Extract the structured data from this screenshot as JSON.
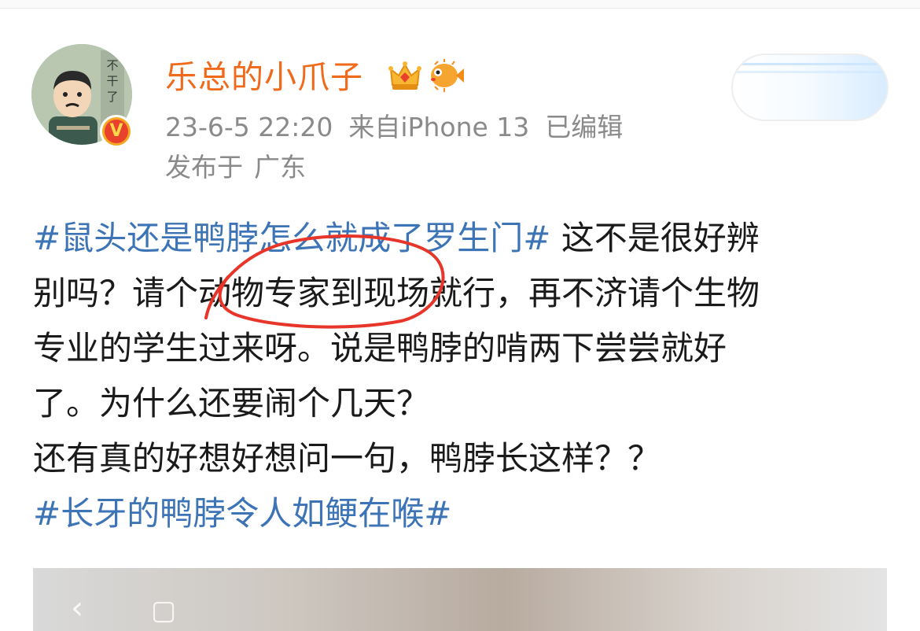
{
  "post": {
    "author": {
      "name": "乐总的小爪子",
      "avatar_banner_text": "不干了",
      "verified_mark": "V"
    },
    "timestamp": "23-6-5 22:20",
    "source": "来自iPhone 13",
    "edited": "已编辑",
    "location_prefix": "发布于",
    "location": "广东",
    "lines": [
      {
        "hashtag": "#鼠头还是鸭脖怎么就成了罗生门#",
        "text": " 这不是很好辨"
      },
      {
        "text": "别吗？请个动物专家到现场就行，再不济请个生物"
      },
      {
        "text": "专业的学生过来呀。说是鸭脖的啃两下尝尝就好"
      },
      {
        "text": "了。为什么还要闹个几天？"
      },
      {
        "text": "还有真的好想好想问一句，鸭脖长这样？？"
      },
      {
        "hashtag": "#长牙的鸭脖令人如鲠在喉#"
      }
    ]
  },
  "icons": {
    "crown": "crown-membership-icon",
    "fish": "pufferfish-badge-icon",
    "verified": "verified-badge-icon"
  },
  "colors": {
    "username": "#ef6a1a",
    "meta": "#8a8a8a",
    "hashtag": "#3d74b6",
    "body": "#1a1a1a",
    "annotation": "#e8352a"
  }
}
